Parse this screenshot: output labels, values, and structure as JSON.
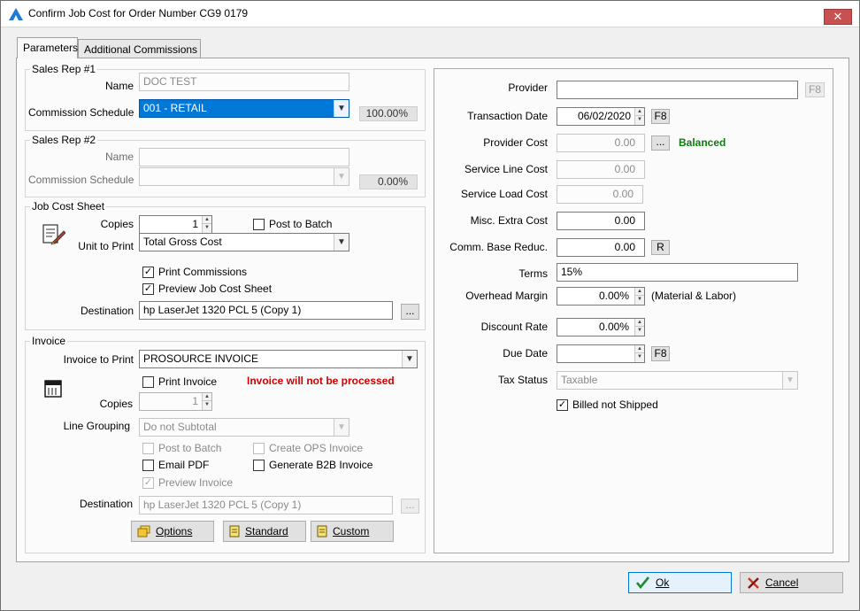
{
  "window": {
    "title": "Confirm Job Cost for Order Number CG9 0179",
    "close_symbol": "✕"
  },
  "tabs": [
    {
      "label": "Parameters"
    },
    {
      "label": "Additional Commissions"
    }
  ],
  "sales_rep_1": {
    "title": "Sales Rep #1",
    "name_label": "Name",
    "name_value": "DOC TEST",
    "schedule_label": "Commission Schedule",
    "schedule_value": "001 - RETAIL",
    "percent": "100.00%"
  },
  "sales_rep_2": {
    "title": "Sales Rep #2",
    "name_label": "Name",
    "name_value": "",
    "schedule_label": "Commission Schedule",
    "schedule_value": "",
    "percent": "0.00%"
  },
  "job_cost_sheet": {
    "title": "Job Cost Sheet",
    "copies_label": "Copies",
    "copies_value": "1",
    "post_to_batch": "Post to Batch",
    "unit_label": "Unit to Print",
    "unit_value": "Total Gross Cost",
    "print_commissions": "Print Commissions",
    "preview": "Preview Job Cost Sheet",
    "destination_label": "Destination",
    "destination_value": "hp LaserJet 1320 PCL 5 (Copy 1)",
    "browse": "..."
  },
  "invoice": {
    "title": "Invoice",
    "print_label": "Invoice to Print",
    "print_value": "PROSOURCE INVOICE",
    "print_invoice": "Print Invoice",
    "warning": "Invoice will not be processed",
    "copies_label": "Copies",
    "copies_value": "1",
    "grouping_label": "Line Grouping",
    "grouping_value": "Do not Subtotal",
    "post_to_batch": "Post to Batch",
    "create_ops": "Create OPS Invoice",
    "email_pdf": "Email PDF",
    "generate_b2b": "Generate B2B Invoice",
    "preview": "Preview Invoice",
    "destination_label": "Destination",
    "destination_value": "hp LaserJet 1320 PCL 5 (Copy 1)",
    "browse": "...",
    "options": "Options",
    "standard": "Standard",
    "custom": "Custom"
  },
  "right": {
    "provider_label": "Provider",
    "provider_value": "",
    "f8": "F8",
    "transaction_date_label": "Transaction Date",
    "transaction_date": "06/02/2020",
    "provider_cost_label": "Provider Cost",
    "provider_cost": "0.00",
    "browse": "...",
    "balanced": "Balanced",
    "service_line_label": "Service Line Cost",
    "service_line": "0.00",
    "service_load_label": "Service Load Cost",
    "service_load": "0.00",
    "misc_label": "Misc. Extra Cost",
    "misc": "0.00",
    "comm_label": "Comm. Base Reduc.",
    "comm": "0.00",
    "r": "R",
    "terms_label": "Terms",
    "terms": "15%",
    "overhead_label": "Overhead Margin",
    "overhead": "0.00%",
    "overhead_note": "(Material & Labor)",
    "discount_label": "Discount Rate",
    "discount": "0.00%",
    "due_date_label": "Due Date",
    "due_date": "",
    "tax_label": "Tax Status",
    "tax_value": "Taxable",
    "billed_not_shipped": "Billed not Shipped"
  },
  "footer": {
    "ok": "Ok",
    "cancel": "Cancel"
  },
  "checks": {
    "on": "✓",
    "off": ""
  },
  "symbols": {
    "down": "▼",
    "up_small": "▲",
    "down_small": "▼"
  },
  "colors": {
    "accent": "#0078d7",
    "warning": "#d00000",
    "balanced": "#107c10"
  }
}
